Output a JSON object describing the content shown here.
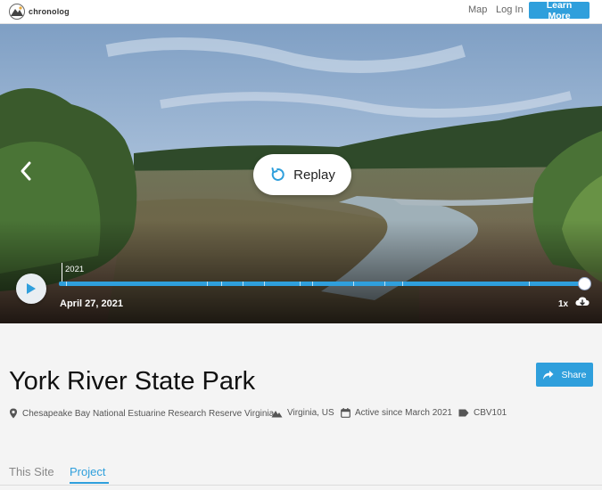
{
  "header": {
    "brand": "chronolog",
    "nav": {
      "map": "Map",
      "login": "Log In"
    },
    "cta": "Learn More"
  },
  "player": {
    "replay_label": "Replay",
    "year_marker": "2021",
    "current_date": "April 27, 2021",
    "speed": "1x"
  },
  "site": {
    "title": "York River State Park",
    "share_label": "Share",
    "meta": {
      "location": "Chesapeake Bay National Estuarine Research Reserve Virginia",
      "region": "Virginia, US",
      "active": "Active since March 2021",
      "tag": "CBV101"
    }
  },
  "tabs": [
    {
      "label": "This Site"
    },
    {
      "label": "Project"
    }
  ],
  "colors": {
    "accent": "#2f9fdc"
  }
}
